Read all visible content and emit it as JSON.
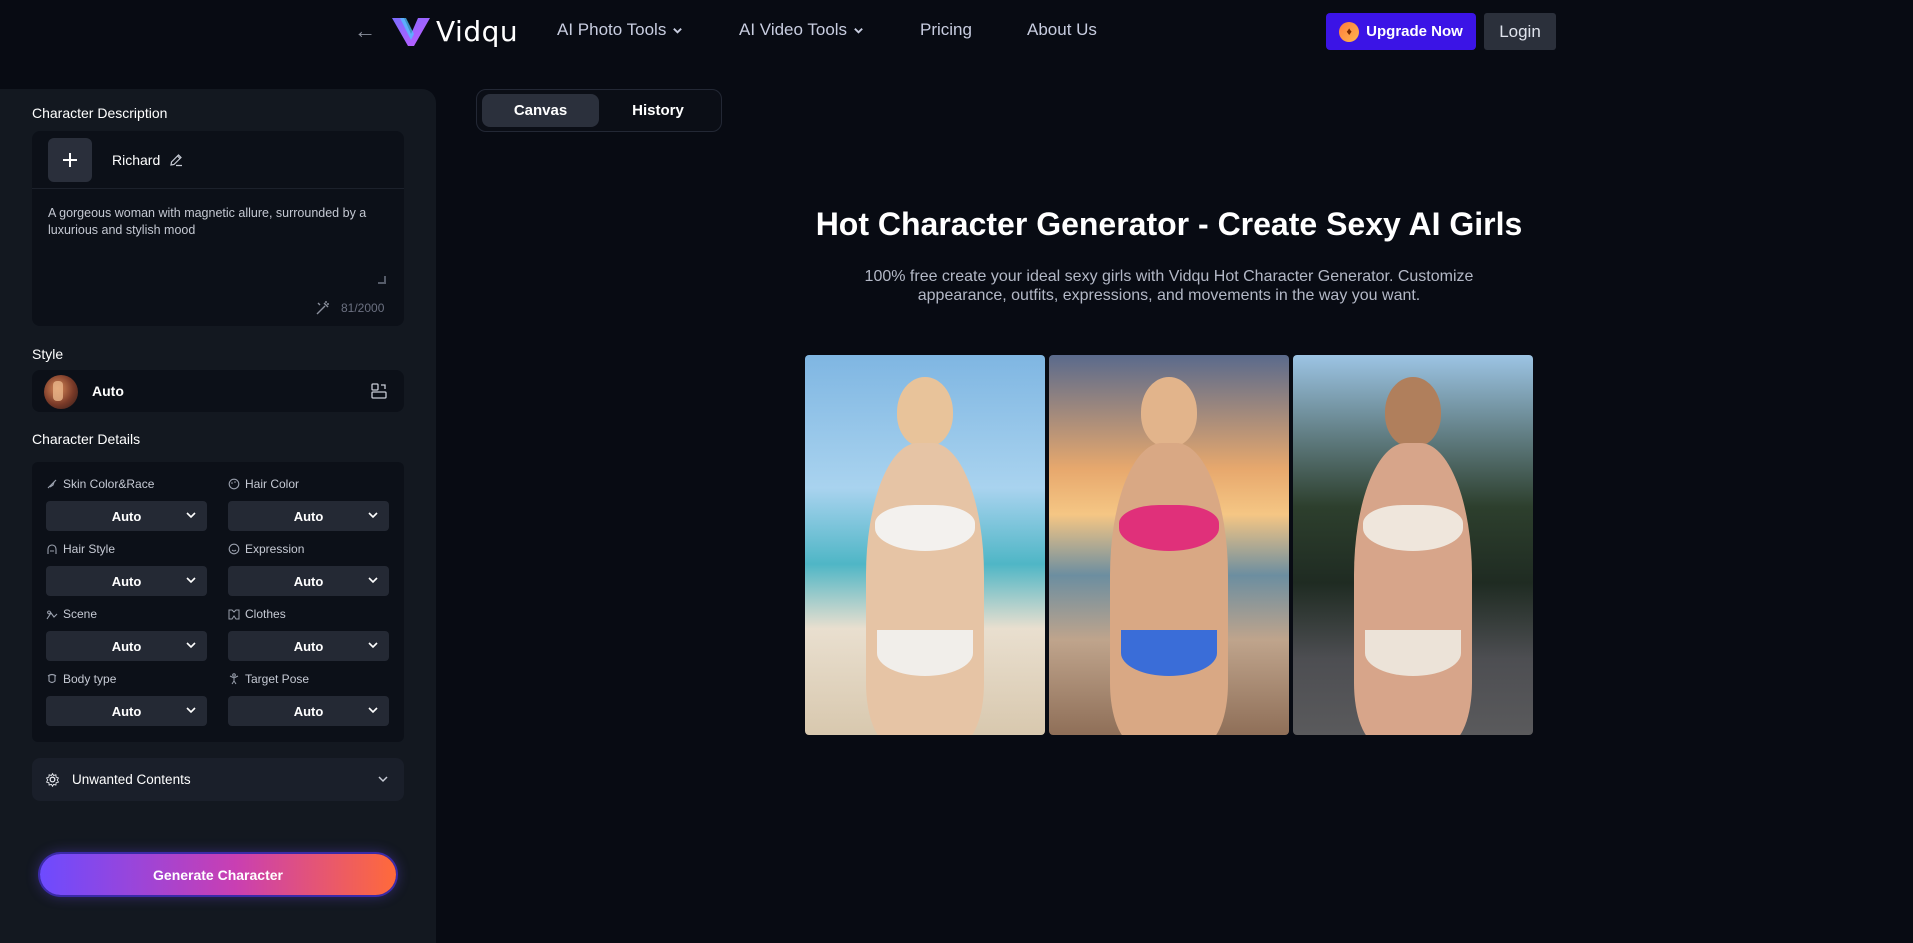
{
  "nav": {
    "logo_text": "Vidqu",
    "items": [
      {
        "label": "AI Photo Tools",
        "dropdown": true
      },
      {
        "label": "AI Video Tools",
        "dropdown": true
      },
      {
        "label": "Pricing",
        "dropdown": false
      },
      {
        "label": "About Us",
        "dropdown": false
      }
    ],
    "upgrade_label": "Upgrade Now",
    "login_label": "Login"
  },
  "left": {
    "description_title": "Character Description",
    "character_name": "Richard",
    "description_text": "A gorgeous woman with magnetic allure, surrounded by a luxurious and stylish mood",
    "char_count": "81/2000",
    "style_title": "Style",
    "style_value": "Auto",
    "details_title": "Character Details",
    "details": [
      {
        "label": "Skin Color&Race",
        "value": "Auto",
        "icon": "brush-icon"
      },
      {
        "label": "Hair Color",
        "value": "Auto",
        "icon": "palette-icon"
      },
      {
        "label": "Hair Style",
        "value": "Auto",
        "icon": "hair-icon"
      },
      {
        "label": "Expression",
        "value": "Auto",
        "icon": "smile-icon"
      },
      {
        "label": "Scene",
        "value": "Auto",
        "icon": "scene-icon"
      },
      {
        "label": "Clothes",
        "value": "Auto",
        "icon": "clothes-icon"
      },
      {
        "label": "Body type",
        "value": "Auto",
        "icon": "body-icon"
      },
      {
        "label": "Target Pose",
        "value": "Auto",
        "icon": "pose-icon"
      }
    ],
    "unwanted_label": "Unwanted Contents",
    "generate_label": "Generate Character"
  },
  "main": {
    "tabs": [
      {
        "label": "Canvas",
        "active": true
      },
      {
        "label": "History",
        "active": false
      }
    ],
    "title": "Hot Character Generator - Create Sexy AI Girls",
    "subtitle": "100% free create your ideal sexy girls with Vidqu Hot Character Generator. Customize appearance, outfits, expressions, and movements in the way you want."
  },
  "colors": {
    "background": "#080b13",
    "panel": "#131820",
    "upgrade": "#3b14e6",
    "generate_gradient_start": "#6d4bff",
    "generate_gradient_end": "#ff6a3a"
  }
}
